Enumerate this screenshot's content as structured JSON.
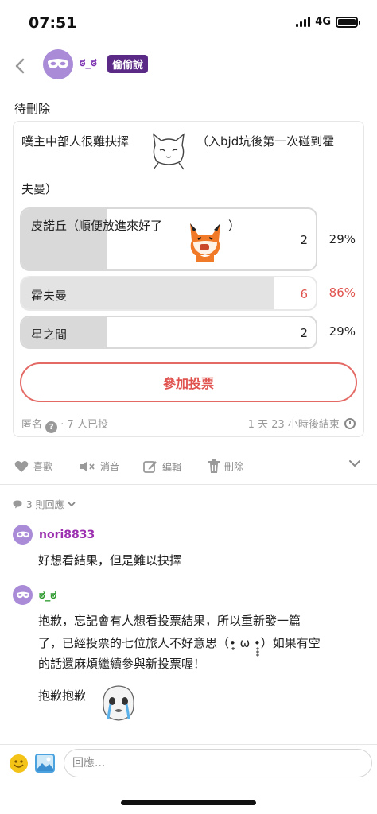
{
  "status": {
    "time": "07:51",
    "network": "4G"
  },
  "header": {
    "name": "ಠ_ಠ",
    "badge": "偷偷說"
  },
  "post": {
    "pending_label": "待刪除",
    "text_line1": "噗主中部人很難抉擇",
    "text_line1b": "（入bjd坑後第一次碰到霍",
    "text_line2": "夫曼）",
    "poll": {
      "options": [
        {
          "label": "皮諾丘（順便放進來好了",
          "label_end": "）",
          "count": "2",
          "percent": "29%",
          "fraction": 0.29,
          "voted": false
        },
        {
          "label": "霍夫曼",
          "count": "6",
          "percent": "86%",
          "fraction": 0.86,
          "voted": true
        },
        {
          "label": "星之間",
          "count": "2",
          "percent": "29%",
          "fraction": 0.29,
          "voted": false
        }
      ],
      "vote_button": "參加投票",
      "anonymous": "匿名",
      "voters": "· 7 人已投",
      "ends_in": "1 天 23 小時後結束"
    }
  },
  "actions": {
    "like": "喜歡",
    "mute": "消音",
    "edit": "編輯",
    "delete": "刪除"
  },
  "comments": {
    "count_label": "3 則回應",
    "items": [
      {
        "name": "nori8833",
        "name_color": "#9b2fb0",
        "lines": [
          "好想看結果，但是難以抉擇"
        ]
      },
      {
        "name": "ಠ_ಠ",
        "name_color": "#2e9a2e",
        "lines": [
          "抱歉，忘記會有人想看投票結果，所以重新發一篇",
          "了，已經投票的七位旅人不好意思（•̥̥̥ ω •̥̥̥）如果有空",
          "的話還麻煩繼續參與新投票喔！",
          "抱歉抱歉"
        ]
      }
    ]
  },
  "input": {
    "placeholder": "回應..."
  },
  "colors": {
    "accent_red": "#e0524e",
    "badge_purple": "#5b2a86",
    "avatar_purple": "#a98bd8"
  }
}
